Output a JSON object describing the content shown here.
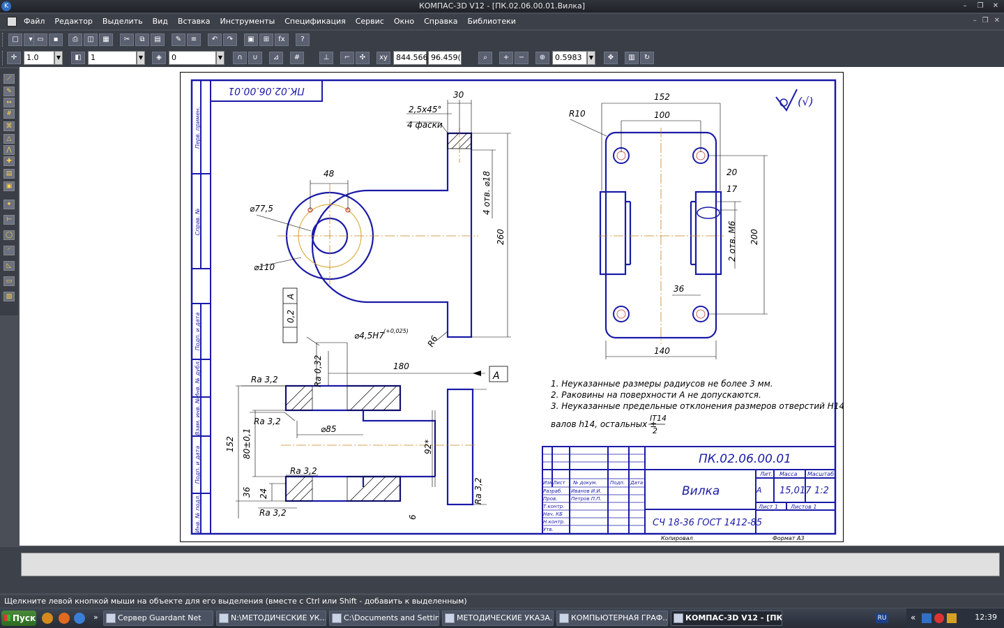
{
  "window": {
    "title": "КОМПАС-3D V12 - [ПК.02.06.00.01.Вилка]"
  },
  "menu": [
    "Файл",
    "Редактор",
    "Выделить",
    "Вид",
    "Вставка",
    "Инструменты",
    "Спецификация",
    "Сервис",
    "Окно",
    "Справка",
    "Библиотеки"
  ],
  "toolbar2": {
    "step": "1.0",
    "layer": "1",
    "style": "0",
    "x": "844.566",
    "y": "96.459(",
    "zoom": "0.5983"
  },
  "drawing": {
    "dims": {
      "d30": "30",
      "chamfer": "2,5х45°",
      "chamfer_count": "4 фаски",
      "d48": "48",
      "d77": "⌀77,5",
      "d110": "⌀110",
      "holes18": "4 отв. ⌀18",
      "d260": "260",
      "r6": "R6",
      "fit": "⌀4,5Н7",
      "fit_tol": "(+0,025)",
      "d152top": "152",
      "d100": "100",
      "r10": "R10",
      "d20": "20",
      "d17": "17",
      "m6": "2 отв. М6",
      "d200": "200",
      "d36r": "36",
      "d140": "140",
      "d180": "180",
      "dA": "А",
      "d85": "⌀85",
      "d92": "92*",
      "d80": "80±0,1",
      "d152": "152",
      "d36": "36",
      "d24": "24",
      "d6": "6",
      "ra32a": "Ra 3,2",
      "ra32b": "Ra 3,2",
      "ra32c": "Ra 3,2",
      "ra32d": "Ra 3,2",
      "ra032": "Ra 0,32",
      "ra32e": "Ra 3,2",
      "tol02": "0,2",
      "tolA": "А",
      "roughness": "(√)"
    },
    "stamp_rotated": "ПК.02.06.00.01",
    "notes": [
      "1. Неуказанные размеры радиусов не более 3 мм.",
      "2. Раковины на поверхности  А не допускаются.",
      "3. Неуказанные предельные отклонения размеров отверстий Н14,"
    ],
    "note4_prefix": "валов h14, остальных ±",
    "note4_num": "IT14",
    "note4_den": "2",
    "side_labels": [
      "Перв. примен.",
      "Справ. №",
      "Подп. и дата",
      "Инв. № дубл.",
      "Взам. инв. №",
      "Подп. и дата",
      "Инв. № подл."
    ],
    "titleblock": {
      "designation": "ПК.02.06.00.01",
      "name": "Вилка",
      "material": "СЧ 18-36 ГОСТ 1412-85",
      "h_izm": "Изм.",
      "h_list": "Лист",
      "h_ndoc": "№ докум.",
      "h_podp": "Подп.",
      "h_data": "Дата",
      "r_razrab": "Разраб.",
      "n_razrab": "Иванов И.И.",
      "r_prov": "Пров.",
      "n_prov": "Петров П.П.",
      "r_tkontr": "Т.контр.",
      "r_nkontr": "Н.контр.",
      "r_utv": "Утв.",
      "r_kb": "Нач. КБ",
      "h_lit": "Лит.",
      "h_mass": "Масса",
      "h_scale": "Масштаб",
      "lit": "А",
      "mass": "15,017",
      "scale": "1:2",
      "sheet": "Лист   1",
      "sheets": "Листов   1",
      "copied": "Копировал",
      "format": "Формат     А3"
    }
  },
  "status_text": "Щелкните левой кнопкой мыши на объекте для его выделения (вместе с Ctrl или Shift - добавить к выделенным)",
  "taskbar": {
    "start": "Пуск",
    "tasks": [
      "Сервер Guardant Net",
      "N:\\МЕТОДИЧЕСКИЕ УК...",
      "C:\\Documents and Settin...",
      "МЕТОДИЧЕСКИЕ УКАЗА...",
      "КОМПЬЮТЕРНАЯ ГРАФ...",
      "КОМПАС-3D V12 - [ПК..."
    ],
    "lang": "RU",
    "clock": "12:39"
  }
}
